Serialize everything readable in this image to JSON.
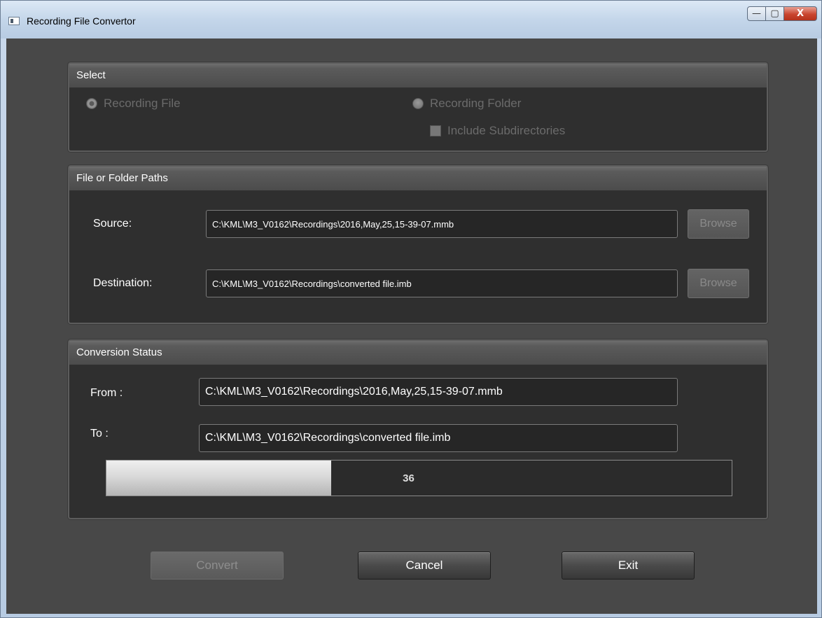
{
  "window": {
    "title": "Recording File Convertor",
    "controls": {
      "minimize": "—",
      "maximize": "▢",
      "close": "X"
    }
  },
  "select_group": {
    "title": "Select",
    "recording_file": {
      "label": "Recording File",
      "checked": true
    },
    "recording_folder": {
      "label": "Recording Folder",
      "checked": false
    },
    "include_subdirectories": {
      "label": "Include Subdirectories",
      "checked": false
    }
  },
  "paths_group": {
    "title": "File or Folder Paths",
    "source_label": "Source:",
    "source_value": "C:\\KML\\M3_V0162\\Recordings\\2016,May,25,15-39-07.mmb",
    "destination_label": "Destination:",
    "destination_value": "C:\\KML\\M3_V0162\\Recordings\\converted file.imb",
    "browse_label": "Browse"
  },
  "status_group": {
    "title": "Conversion Status",
    "from_label": "From :",
    "from_value": "C:\\KML\\M3_V0162\\Recordings\\2016,May,25,15-39-07.mmb",
    "to_label": "To :",
    "to_value": "C:\\KML\\M3_V0162\\Recordings\\converted file.imb",
    "progress_value": 36,
    "progress_text": "36"
  },
  "buttons": {
    "convert": "Convert",
    "cancel": "Cancel",
    "exit": "Exit"
  }
}
